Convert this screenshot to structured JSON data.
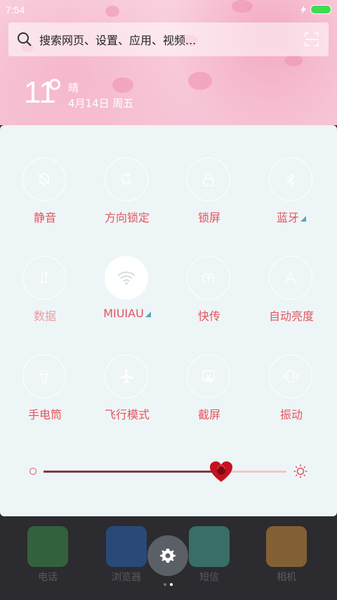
{
  "status_bar": {
    "time": "7:54"
  },
  "search": {
    "placeholder": "搜索网页、设置、应用、视频..."
  },
  "weather": {
    "temperature": "11",
    "condition": "晴",
    "date": "4月14日 周五"
  },
  "quick_settings": [
    {
      "label": "静音",
      "icon": "bell-off-icon",
      "state": "off"
    },
    {
      "label": "方向锁定",
      "icon": "rotation-lock-icon",
      "state": "off"
    },
    {
      "label": "锁屏",
      "icon": "lock-icon",
      "state": "off"
    },
    {
      "label": "蓝牙",
      "icon": "bluetooth-icon",
      "state": "off"
    },
    {
      "label": "数据",
      "icon": "mobile-data-icon",
      "state": "disabled"
    },
    {
      "label": "MIUIAU",
      "icon": "wifi-icon",
      "state": "on"
    },
    {
      "label": "快传",
      "icon": "quick-transfer-icon",
      "state": "off"
    },
    {
      "label": "自动亮度",
      "icon": "auto-brightness-icon",
      "state": "off"
    },
    {
      "label": "手电筒",
      "icon": "flashlight-icon",
      "state": "off"
    },
    {
      "label": "飞行模式",
      "icon": "airplane-icon",
      "state": "off"
    },
    {
      "label": "截屏",
      "icon": "screenshot-icon",
      "state": "off"
    },
    {
      "label": "振动",
      "icon": "vibrate-icon",
      "state": "off"
    }
  ],
  "brightness": {
    "level": 0.73
  },
  "dock": [
    {
      "label": "电话",
      "icon": "phone-icon",
      "color": "#3fa34d"
    },
    {
      "label": "浏览器",
      "icon": "globe-icon",
      "color": "#2b6fd1"
    },
    {
      "label": "短信",
      "icon": "message-icon",
      "color": "#4cc2a9"
    },
    {
      "label": "相机",
      "icon": "camera-icon",
      "color": "#f0a23a"
    }
  ],
  "colors": {
    "accent": "#e4545f",
    "panel_bg": "#eef5f6",
    "expand_marker": "#5aa6b6"
  }
}
